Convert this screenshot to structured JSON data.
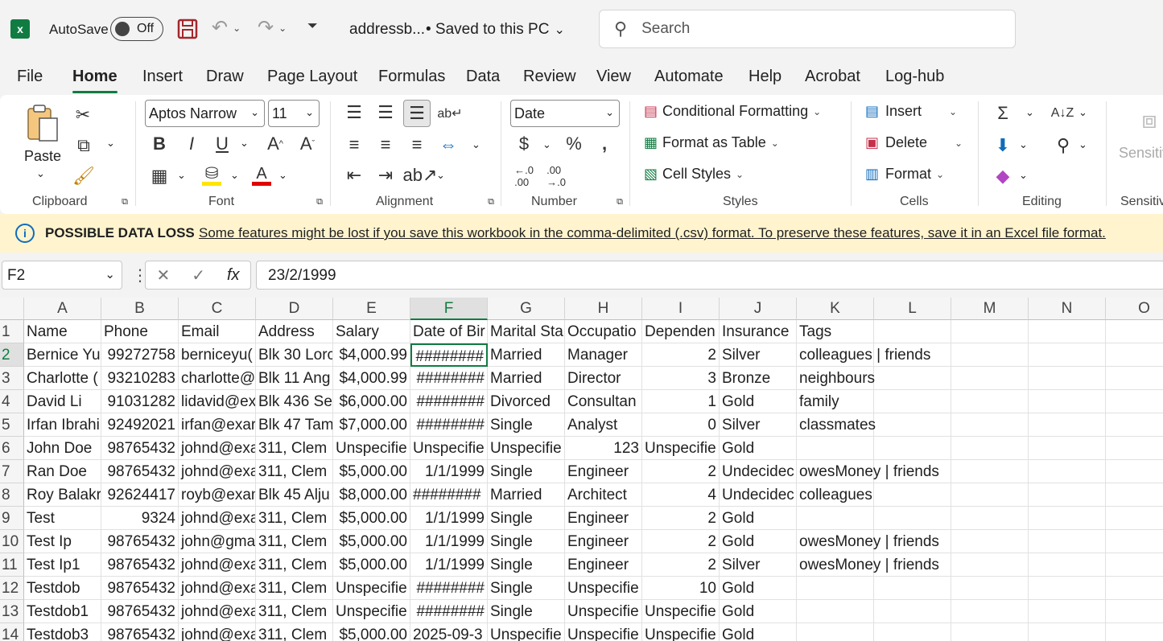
{
  "titlebar": {
    "autosave_label": "AutoSave",
    "autosave_state": "Off",
    "file_name": "addressb...",
    "save_status": "• Saved to this PC",
    "search_placeholder": "Search"
  },
  "menu": [
    "File",
    "Home",
    "Insert",
    "Draw",
    "Page Layout",
    "Formulas",
    "Data",
    "Review",
    "View",
    "Automate",
    "Help",
    "Acrobat",
    "Log-hub"
  ],
  "ribbon": {
    "paste": "Paste",
    "clipboard": "Clipboard",
    "font_name": "Aptos Narrow",
    "font_size": "11",
    "font": "Font",
    "alignment": "Alignment",
    "number_format": "Date",
    "number": "Number",
    "conditional_formatting": "Conditional Formatting",
    "format_as_table": "Format as Table",
    "cell_styles": "Cell Styles",
    "styles": "Styles",
    "insert": "Insert",
    "delete": "Delete",
    "format": "Format",
    "cells": "Cells",
    "editing": "Editing",
    "sensitivity": "Sensitiv",
    "sensitivity_group": "Sensitiv"
  },
  "banner": {
    "title": "POSSIBLE DATA LOSS",
    "message": "Some features might be lost if you save this workbook in the comma-delimited (.csv) format. To preserve these features, save it in an Excel file format."
  },
  "formula_bar": {
    "name_box": "F2",
    "value": "23/2/1999"
  },
  "columns": [
    "A",
    "B",
    "C",
    "D",
    "E",
    "F",
    "G",
    "H",
    "I",
    "J",
    "K",
    "L",
    "M",
    "N",
    "O"
  ],
  "rows": [
    [
      "Name",
      "Phone",
      "Email",
      "Address",
      "Salary",
      "Date of Bir",
      "Marital Sta",
      "Occupatio",
      "Dependen",
      "Insurance",
      "Tags",
      "",
      "",
      "",
      ""
    ],
    [
      "Bernice Yu",
      "99272758",
      "berniceyu(",
      "Blk 30 Lorc",
      "$4,000.99",
      "########",
      "Married",
      "Manager",
      "2",
      "Silver",
      "colleagues | friends",
      "",
      "",
      "",
      ""
    ],
    [
      "Charlotte (",
      "93210283",
      "charlotte@",
      "Blk 11 Ang",
      "$4,000.99",
      "########",
      "Married",
      "Director",
      "3",
      "Bronze",
      "neighbours",
      "",
      "",
      "",
      ""
    ],
    [
      "David Li",
      "91031282",
      "lidavid@ex",
      "Blk 436 Se",
      "$6,000.00",
      "########",
      "Divorced",
      "Consultan",
      "1",
      "Gold",
      "family",
      "",
      "",
      "",
      ""
    ],
    [
      "Irfan Ibrahi",
      "92492021",
      "irfan@exar",
      "Blk 47 Tam",
      "$7,000.00",
      "########",
      "Single",
      "Analyst",
      "0",
      "Silver",
      "classmates",
      "",
      "",
      "",
      ""
    ],
    [
      "John Doe",
      "98765432",
      "johnd@exa",
      "311, Clem",
      "Unspecifie",
      "Unspecifie",
      "Unspecifie",
      "123",
      "Unspecifie",
      "Gold",
      "",
      "",
      "",
      "",
      ""
    ],
    [
      "Ran Doe",
      "98765432",
      "johnd@exa",
      "311, Clem",
      "$5,000.00",
      "1/1/1999",
      "Single",
      "Engineer",
      "2",
      "Undecidec",
      "owesMoney | friends",
      "",
      "",
      "",
      ""
    ],
    [
      "Roy Balakr",
      "92624417",
      "royb@exan",
      "Blk 45 Alju",
      "$8,000.00",
      "########",
      "Married",
      "Architect",
      "4",
      "Undecidec",
      "colleagues",
      "",
      "",
      "",
      ""
    ],
    [
      "Test",
      "9324",
      "johnd@exa",
      "311, Clem",
      "$5,000.00",
      "1/1/1999",
      "Single",
      "Engineer",
      "2",
      "Gold",
      "",
      "",
      "",
      "",
      ""
    ],
    [
      "Test Ip",
      "98765432",
      "john@gma",
      "311, Clem",
      "$5,000.00",
      "1/1/1999",
      "Single",
      "Engineer",
      "2",
      "Gold",
      "owesMoney | friends",
      "",
      "",
      "",
      ""
    ],
    [
      "Test Ip1",
      "98765432",
      "johnd@exa",
      "311, Clem",
      "$5,000.00",
      "1/1/1999",
      "Single",
      "Engineer",
      "2",
      "Silver",
      "owesMoney | friends",
      "",
      "",
      "",
      ""
    ],
    [
      "Testdob",
      "98765432",
      "johnd@exa",
      "311, Clem",
      "Unspecifie",
      "########",
      "Single",
      "Unspecifie",
      "10",
      "Gold",
      "",
      "",
      "",
      "",
      ""
    ],
    [
      "Testdob1",
      "98765432",
      "johnd@exa",
      "311, Clem",
      "Unspecifie",
      "########",
      "Single",
      "Unspecifie",
      "Unspecifie",
      "Gold",
      "",
      "",
      "",
      "",
      ""
    ],
    [
      "Testdob3",
      "98765432",
      "johnd@exa",
      "311, Clem",
      "$5,000.00",
      "2025-09-3",
      "Unspecifie",
      "Unspecifie",
      "Unspecifie",
      "Gold",
      "",
      "",
      "",
      "",
      ""
    ]
  ],
  "numeric_cells": [
    "1-1",
    "2-1",
    "3-1",
    "4-1",
    "5-1",
    "6-1",
    "7-1",
    "8-1",
    "9-1",
    "10-1",
    "11-1",
    "12-1",
    "13-1",
    "1-4",
    "2-4",
    "3-4",
    "4-4",
    "6-4",
    "7-4",
    "8-4",
    "9-4",
    "10-4",
    "13-4",
    "1-5",
    "2-5",
    "3-5",
    "4-5",
    "6-5",
    "8-5",
    "9-5",
    "10-5",
    "11-5",
    "12-5",
    "1-8",
    "2-8",
    "3-8",
    "4-8",
    "6-8",
    "7-8",
    "8-8",
    "9-8",
    "10-8",
    "11-8",
    "5-7"
  ],
  "active_cell": "1-5"
}
